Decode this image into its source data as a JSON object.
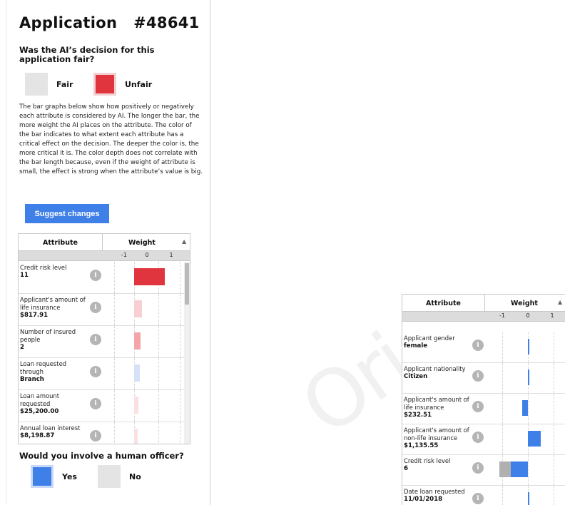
{
  "app": {
    "title_label": "Application",
    "app_id": "#48641"
  },
  "fairness": {
    "question": "Was the AI’s decision for this application fair?",
    "fair_label": "Fair",
    "unfair_label": "Unfair",
    "selected": "Unfair"
  },
  "description": "The bar graphs below show how positively or negatively each attribute is considered by AI. The longer the bar, the more weight the AI places on the attribute. The color of the bar indicates to what extent each attribute has a critical effect on the decision. The deeper the color is, the more critical it is. The color depth does not correlate with the bar length because, even if the weight of attribute is small, the effect is strong when the attribute’s value is big.",
  "suggest_button": "Suggest changes",
  "left_table": {
    "col_attribute": "Attribute",
    "col_weight": "Weight",
    "axis_ticks": [
      "-1",
      "0",
      "1"
    ],
    "info_glyph": "i",
    "rows": [
      {
        "name": "Credit risk level",
        "value": "11",
        "weight": 0.9,
        "color": "#e0353f"
      },
      {
        "name": "Applicant's amount of life insurance",
        "value": "$817.91",
        "weight": 0.22,
        "color": "#f8d0d3"
      },
      {
        "name": "Number of insured people",
        "value": "2",
        "weight": 0.18,
        "color": "#f3a5aa"
      },
      {
        "name": "Loan requested through",
        "value": "Branch",
        "weight": 0.16,
        "color": "#d5e1f7"
      },
      {
        "name": "Loan amount requested",
        "value": "$25,200.00",
        "weight": 0.12,
        "color": "#fbe0e2"
      },
      {
        "name": "Annual loan interest",
        "value": "$8,198.87",
        "weight": 0.1,
        "color": "#fbe0e2"
      }
    ]
  },
  "human_officer": {
    "question": "Would you involve a human officer?",
    "yes_label": "Yes",
    "no_label": "No",
    "selected": "Yes"
  },
  "right_table": {
    "col_attribute": "Attribute",
    "col_weight": "Weight",
    "axis_ticks": [
      "-1",
      "0",
      "1"
    ],
    "info_glyph": "i",
    "rows": [
      {
        "name": "Applicant gender",
        "value": "female",
        "weight": 0.02,
        "color": "#3f7fe8"
      },
      {
        "name": "Applicant nationality",
        "value": "Citizen",
        "weight": 0.02,
        "color": "#3f7fe8"
      },
      {
        "name": "Applicant's amount of life insurance",
        "value": "$232.51",
        "weight": -0.2,
        "color": "#3f7fe8"
      },
      {
        "name": "Applicant's amount of non-life insurance",
        "value": "$1,135.55",
        "weight": 0.45,
        "color": "#3f7fe8"
      },
      {
        "name": "Credit risk level",
        "value": "6",
        "weight": -0.6,
        "color": "#3f7fe8",
        "secondary_weight": -1.0,
        "secondary_color": "#b0b0b0"
      },
      {
        "name": "Date loan requested",
        "value": "11/01/2018",
        "weight": 0.05,
        "color": "#3f7fe8"
      }
    ]
  },
  "colors": {
    "accent_blue": "#3f7fe8",
    "accent_red": "#e0353f",
    "neutral_grey": "#e4e4e4"
  }
}
